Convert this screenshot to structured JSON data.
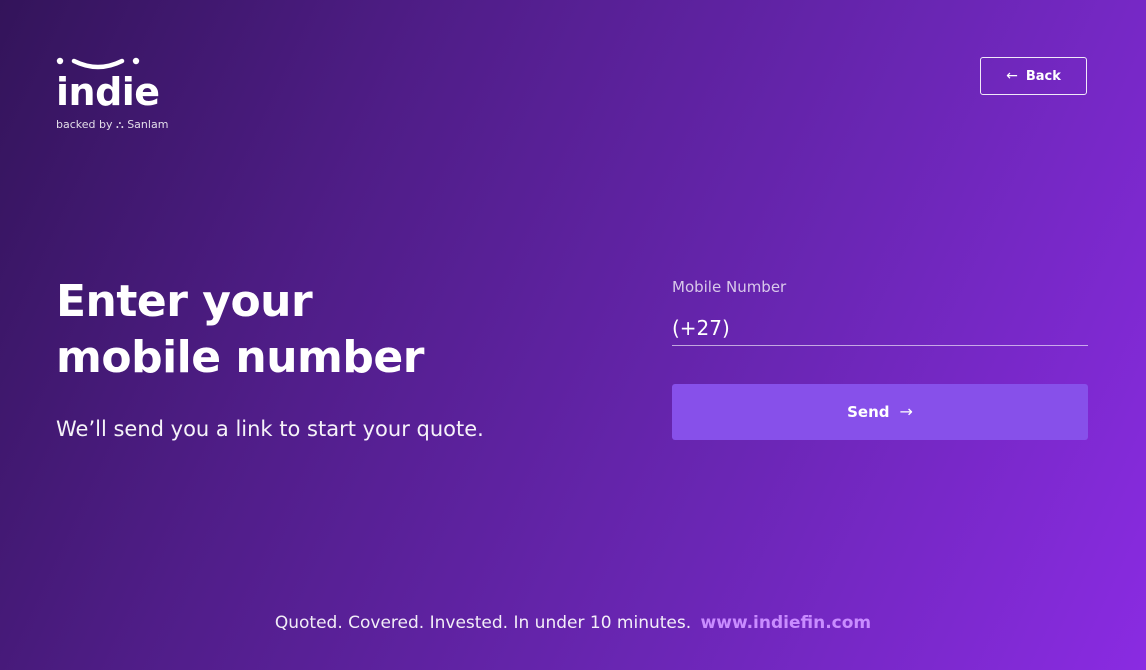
{
  "brand": {
    "logo_text": "indie",
    "tagline": "backed by",
    "partner": "Sanlam"
  },
  "header": {
    "back_label": "Back",
    "back_icon": "arrow-left-icon"
  },
  "main": {
    "headline_line1": "Enter your",
    "headline_line2": "mobile number",
    "subtitle": "We’ll send you a link to start your quote."
  },
  "form": {
    "mobile_label": "Mobile Number",
    "mobile_value": "(+27)",
    "send_label": "Send",
    "send_icon": "arrow-right-icon"
  },
  "footer": {
    "text": "Quoted. Covered. Invested. In under 10 minutes.",
    "link": "www.indiefin.com"
  },
  "colors": {
    "gradient_start": "#33145a",
    "gradient_end": "#8a2be2",
    "button": "#8750ea",
    "link": "#c98cff",
    "text": "#ffffff"
  }
}
